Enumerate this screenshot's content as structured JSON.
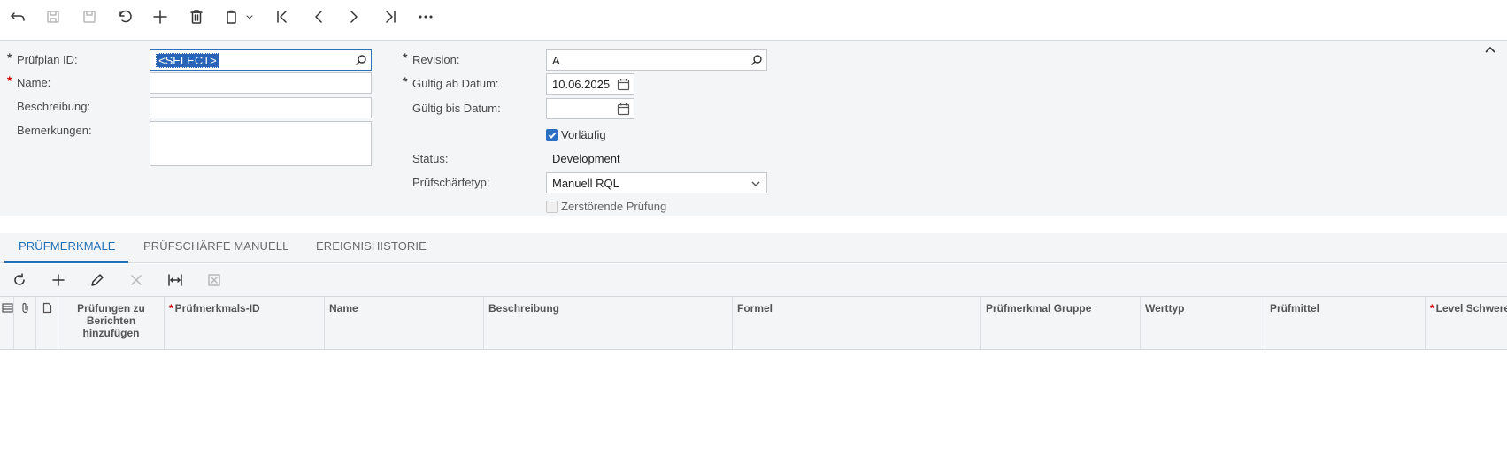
{
  "toolbar": {
    "buttons": [
      {
        "name": "back-icon"
      },
      {
        "name": "save-close-icon"
      },
      {
        "name": "save-icon"
      },
      {
        "name": "undo-icon"
      },
      {
        "name": "add-icon"
      },
      {
        "name": "delete-icon"
      },
      {
        "name": "clipboard-icon"
      },
      {
        "name": "first-record-icon"
      },
      {
        "name": "previous-record-icon"
      },
      {
        "name": "next-record-icon"
      },
      {
        "name": "last-record-icon"
      },
      {
        "name": "more-icon"
      }
    ]
  },
  "form": {
    "pruefplan_id": {
      "label": "Prüfplan ID:",
      "value": "<SELECT>"
    },
    "name": {
      "label": "Name:",
      "value": ""
    },
    "beschreibung": {
      "label": "Beschreibung:",
      "value": ""
    },
    "bemerkungen": {
      "label": "Bemerkungen:",
      "value": ""
    },
    "revision": {
      "label": "Revision:",
      "value": "A"
    },
    "gueltig_ab": {
      "label": "Gültig ab Datum:",
      "value": "10.06.2025"
    },
    "gueltig_bis": {
      "label": "Gültig bis Datum:",
      "value": ""
    },
    "vorlaeufig": {
      "label": "Vorläufig",
      "checked": true
    },
    "status": {
      "label": "Status:",
      "value": "Development"
    },
    "pruefschaerfetyp": {
      "label": "Prüfschärfetyp:",
      "value": "Manuell RQL"
    },
    "zerstoerende_pruefung": {
      "label": "Zerstörende Prüfung",
      "checked": false
    }
  },
  "tabs": [
    {
      "label": "PRÜFMERKMALE",
      "active": true
    },
    {
      "label": "PRÜFSCHÄRFE MANUELL",
      "active": false
    },
    {
      "label": "EREIGNISHISTORIE",
      "active": false
    }
  ],
  "grid": {
    "columns": [
      {
        "label": "Prüfungen zu Berichten hinzufügen",
        "required": false
      },
      {
        "label": "Prüfmerkmals-ID",
        "required": true
      },
      {
        "label": "Name",
        "required": false
      },
      {
        "label": "Beschreibung",
        "required": false
      },
      {
        "label": "Formel",
        "required": false
      },
      {
        "label": "Prüfmerkmal Gruppe",
        "required": false
      },
      {
        "label": "Werttyp",
        "required": false
      },
      {
        "label": "Prüfmittel",
        "required": false
      },
      {
        "label": "Level Schwere",
        "required": true
      }
    ],
    "rows": []
  },
  "colors": {
    "accent": "#1f6fb7",
    "required": "#cc0000",
    "panel_bg": "#f4f5f7"
  }
}
